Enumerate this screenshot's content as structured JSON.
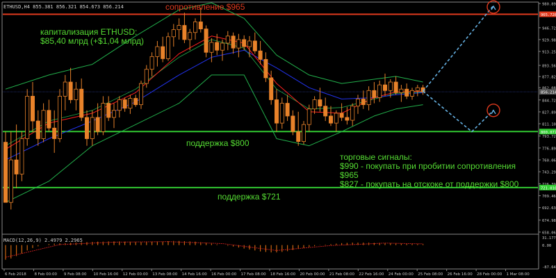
{
  "header": {
    "symbol_info": "ETHUSD,H4 855.381 856.321 854.673 856.214",
    "macd_info": "MACD(12,26,9) 2.4979 2.2965"
  },
  "colors": {
    "background": "#000000",
    "candle_up": "#000000",
    "candle_down": "#e8822a",
    "candle_outline": "#e8822a",
    "resistance": "#e03a1e",
    "support": "#33cc33",
    "bollinger": "#22b14c",
    "ma_fast": "#ff2020",
    "ma_slow": "#2233ee",
    "forecast": "#66b3e6",
    "annotation_green": "#55dd33",
    "annotation_red": "#e03a1e",
    "axis_text": "#c8c8c8",
    "macd_hist": "#cc6611",
    "macd_signal": "#cc2020"
  },
  "annotations": {
    "resistance_label": "сопротивление $965",
    "cap_title": "капитализация ETHUSD:",
    "cap_value": "$85,40 млрд (+$1,04 млрд)",
    "support_800": "поддержка $800",
    "support_721": "поддержка $721",
    "signals_title": "торговые сигналы:",
    "signal_1a": "$990 - покупать при пробитии сопротивления",
    "signal_1b": "$965",
    "signal_2": "$827 - покупать на отскоке от поддержки $800"
  },
  "chart_data": {
    "type": "candlestick",
    "price_axis": {
      "min": 658.0,
      "max": 980.0,
      "ticks": [
        "980.890",
        "946.720",
        "929.985",
        "913.250",
        "893.565",
        "877.825",
        "862.080",
        "844.720",
        "827.895",
        "811.100",
        "793.725",
        "776.890",
        "760.060",
        "743.295",
        "726.390",
        "709.460",
        "692.635",
        "674.980",
        "658.065"
      ],
      "tick_values": [
        980.89,
        946.72,
        929.985,
        913.25,
        893.565,
        877.825,
        862.08,
        844.72,
        827.895,
        811.1,
        793.725,
        776.89,
        760.06,
        743.295,
        726.39,
        709.46,
        692.635,
        674.98,
        658.065
      ],
      "highlighted": [
        {
          "label": "965.728",
          "value": 965.728,
          "color": "#e03a1e"
        },
        {
          "label": "856.214",
          "value": 856.214,
          "color": "#555555"
        },
        {
          "label": "800.077",
          "value": 800.077,
          "color": "#33cc33"
        },
        {
          "label": "721.010",
          "value": 721.01,
          "color": "#33cc33"
        }
      ]
    },
    "macd_axis": {
      "ticks": [
        "31.1773",
        "0.00",
        "-87.6441"
      ],
      "tick_values": [
        31.1773,
        0,
        -87.6441
      ],
      "min": -95,
      "max": 36
    },
    "time_axis": [
      "6 Feb 2018",
      "8 Feb 00:00",
      "9 Feb 08:00",
      "10 Feb 16:00",
      "12 Feb 00:00",
      "13 Feb 08:00",
      "14 Feb 16:00",
      "16 Feb 00:00",
      "17 Feb 08:00",
      "18 Feb 16:00",
      "20 Feb 00:00",
      "21 Feb 08:00",
      "22 Feb 16:00",
      "24 Feb 00:00",
      "25 Feb 08:00",
      "26 Feb 16:00",
      "28 Feb 00:00",
      "1 Mar 08:00"
    ],
    "levels": {
      "resistance": 965.728,
      "support_high": 800.077,
      "support_low": 721.01
    },
    "candles": [
      [
        785,
        800,
        705,
        700
      ],
      [
        700,
        800,
        690,
        760
      ],
      [
        760,
        810,
        720,
        740
      ],
      [
        740,
        800,
        730,
        790
      ],
      [
        790,
        860,
        780,
        850
      ],
      [
        850,
        870,
        800,
        815
      ],
      [
        815,
        830,
        780,
        790
      ],
      [
        790,
        840,
        785,
        830
      ],
      [
        830,
        845,
        800,
        805
      ],
      [
        805,
        830,
        770,
        790
      ],
      [
        790,
        860,
        785,
        850
      ],
      [
        850,
        880,
        830,
        870
      ],
      [
        870,
        890,
        840,
        845
      ],
      [
        845,
        870,
        830,
        860
      ],
      [
        860,
        875,
        815,
        820
      ],
      [
        820,
        830,
        780,
        790
      ],
      [
        790,
        830,
        780,
        820
      ],
      [
        820,
        840,
        795,
        800
      ],
      [
        800,
        850,
        795,
        840
      ],
      [
        840,
        850,
        815,
        820
      ],
      [
        820,
        840,
        805,
        830
      ],
      [
        830,
        850,
        820,
        845
      ],
      [
        845,
        848,
        828,
        833
      ],
      [
        833,
        852,
        825,
        847
      ],
      [
        847,
        852,
        835,
        838
      ],
      [
        838,
        872,
        832,
        868
      ],
      [
        868,
        894,
        862,
        888
      ],
      [
        888,
        912,
        878,
        906
      ],
      [
        906,
        928,
        892,
        920
      ],
      [
        920,
        934,
        898,
        903
      ],
      [
        903,
        940,
        900,
        934
      ],
      [
        934,
        952,
        920,
        944
      ],
      [
        944,
        960,
        930,
        950
      ],
      [
        950,
        968,
        925,
        930
      ],
      [
        930,
        945,
        915,
        940
      ],
      [
        940,
        960,
        930,
        955
      ],
      [
        955,
        975,
        940,
        945
      ],
      [
        945,
        950,
        905,
        912
      ],
      [
        912,
        932,
        898,
        926
      ],
      [
        926,
        938,
        908,
        915
      ],
      [
        915,
        930,
        900,
        925
      ],
      [
        925,
        942,
        915,
        935
      ],
      [
        935,
        940,
        910,
        918
      ],
      [
        918,
        938,
        905,
        930
      ],
      [
        930,
        936,
        915,
        920
      ],
      [
        920,
        935,
        905,
        928
      ],
      [
        928,
        940,
        910,
        914
      ],
      [
        914,
        928,
        895,
        902
      ],
      [
        902,
        912,
        870,
        876
      ],
      [
        876,
        886,
        838,
        845
      ],
      [
        845,
        860,
        800,
        812
      ],
      [
        812,
        848,
        804,
        840
      ],
      [
        840,
        852,
        815,
        822
      ],
      [
        822,
        830,
        795,
        800
      ],
      [
        800,
        828,
        780,
        786
      ],
      [
        786,
        815,
        782,
        810
      ],
      [
        810,
        838,
        800,
        832
      ],
      [
        832,
        850,
        825,
        845
      ],
      [
        845,
        862,
        828,
        836
      ],
      [
        836,
        848,
        815,
        822
      ],
      [
        822,
        836,
        808,
        812
      ],
      [
        812,
        830,
        800,
        826
      ],
      [
        826,
        840,
        815,
        820
      ],
      [
        820,
        835,
        810,
        816
      ],
      [
        816,
        840,
        808,
        836
      ],
      [
        836,
        852,
        825,
        846
      ],
      [
        846,
        858,
        832,
        838
      ],
      [
        838,
        864,
        830,
        858
      ],
      [
        858,
        870,
        840,
        848
      ],
      [
        848,
        872,
        842,
        866
      ],
      [
        866,
        882,
        850,
        858
      ],
      [
        858,
        874,
        848,
        870
      ],
      [
        870,
        878,
        852,
        855
      ],
      [
        855,
        866,
        842,
        860
      ],
      [
        860,
        868,
        846,
        850
      ],
      [
        850,
        862,
        845,
        858
      ],
      [
        858,
        866,
        850,
        862
      ],
      [
        862,
        866,
        852,
        856
      ]
    ],
    "bollinger_upper": [
      [
        0,
        860
      ],
      [
        8,
        880
      ],
      [
        16,
        895
      ],
      [
        24,
        935
      ],
      [
        32,
        972
      ],
      [
        38,
        982
      ],
      [
        44,
        960
      ],
      [
        50,
        908
      ],
      [
        56,
        880
      ],
      [
        62,
        868
      ],
      [
        68,
        874
      ],
      [
        72,
        878
      ],
      [
        77,
        870
      ]
    ],
    "bollinger_lower": [
      [
        0,
        700
      ],
      [
        8,
        730
      ],
      [
        16,
        780
      ],
      [
        24,
        810
      ],
      [
        32,
        840
      ],
      [
        38,
        880
      ],
      [
        44,
        880
      ],
      [
        50,
        790
      ],
      [
        56,
        780
      ],
      [
        62,
        800
      ],
      [
        68,
        822
      ],
      [
        72,
        832
      ],
      [
        77,
        838
      ]
    ],
    "bollinger_mid": [
      [
        0,
        780
      ],
      [
        8,
        815
      ],
      [
        16,
        830
      ],
      [
        24,
        860
      ],
      [
        32,
        905
      ],
      [
        38,
        930
      ],
      [
        44,
        918
      ],
      [
        50,
        860
      ],
      [
        56,
        832
      ],
      [
        62,
        834
      ],
      [
        68,
        846
      ],
      [
        72,
        854
      ],
      [
        77,
        856
      ]
    ],
    "ma_fast": [
      [
        0,
        775
      ],
      [
        8,
        812
      ],
      [
        16,
        826
      ],
      [
        24,
        855
      ],
      [
        32,
        910
      ],
      [
        38,
        935
      ],
      [
        44,
        925
      ],
      [
        50,
        868
      ],
      [
        56,
        828
      ],
      [
        62,
        826
      ],
      [
        68,
        848
      ],
      [
        72,
        856
      ],
      [
        77,
        857
      ]
    ],
    "ma_slow": [
      [
        0,
        760
      ],
      [
        8,
        790
      ],
      [
        16,
        815
      ],
      [
        24,
        842
      ],
      [
        32,
        880
      ],
      [
        38,
        905
      ],
      [
        44,
        915
      ],
      [
        50,
        890
      ],
      [
        56,
        862
      ],
      [
        62,
        846
      ],
      [
        68,
        848
      ],
      [
        72,
        852
      ],
      [
        77,
        855
      ]
    ],
    "forecast_up": {
      "points": [
        [
          77,
          857
        ],
        [
          90,
          978
        ]
      ]
    },
    "forecast_down": {
      "points": [
        [
          77,
          857
        ],
        [
          86,
          800
        ],
        [
          90,
          830
        ]
      ]
    },
    "macd_values": [
      -60,
      -55,
      -45,
      -35,
      -22,
      -12,
      -5,
      0,
      4,
      6,
      7,
      8,
      9,
      10,
      11,
      12,
      13,
      14,
      14,
      15,
      15,
      15,
      14,
      14,
      13,
      12,
      13,
      14,
      15,
      15,
      16,
      17,
      17,
      16,
      15,
      14,
      12,
      9,
      6,
      3,
      0,
      -3,
      -6,
      -10,
      -14,
      -18,
      -22,
      -26,
      -28,
      -30,
      -30,
      -28,
      -25,
      -20,
      -16,
      -12,
      -8,
      -4,
      -1,
      2,
      4,
      6,
      8,
      9,
      10,
      10,
      10,
      10,
      9,
      9,
      8,
      8,
      7,
      6,
      5,
      5,
      4,
      4
    ],
    "macd_signal": [
      [
        0,
        -50
      ],
      [
        10,
        2
      ],
      [
        20,
        12
      ],
      [
        30,
        14
      ],
      [
        40,
        6
      ],
      [
        50,
        -22
      ],
      [
        60,
        -2
      ],
      [
        70,
        8
      ],
      [
        77,
        5
      ]
    ]
  }
}
